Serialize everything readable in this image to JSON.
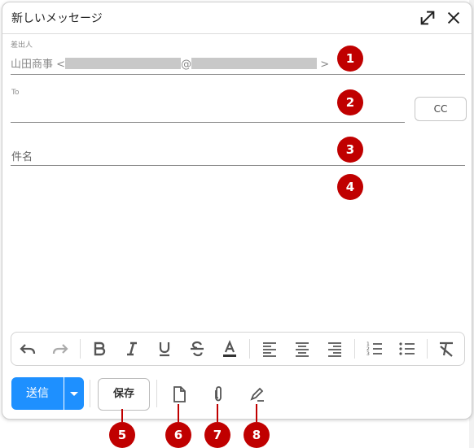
{
  "window": {
    "title": "新しいメッセージ",
    "expand_icon": "expand-icon",
    "close_icon": "close-icon"
  },
  "from": {
    "label": "差出人",
    "name": "山田商事",
    "open": "<",
    "at": "@",
    "close": ">"
  },
  "to": {
    "label": "To",
    "value": "",
    "cc_label": "CC"
  },
  "subject": {
    "placeholder": "件名"
  },
  "toolbar": {
    "items": [
      "undo-icon",
      "redo-icon",
      "bold-icon",
      "italic-icon",
      "underline-icon",
      "strikethrough-icon",
      "text-color-icon",
      "align-left-icon",
      "align-center-icon",
      "align-right-icon",
      "numbered-list-icon",
      "bulleted-list-icon",
      "clear-format-icon"
    ]
  },
  "footer": {
    "send_label": "送信",
    "save_label": "保存",
    "icons": [
      "template-icon",
      "attachment-icon",
      "signature-icon"
    ]
  },
  "annotations": [
    "1",
    "2",
    "3",
    "4",
    "5",
    "6",
    "7",
    "8"
  ],
  "colors": {
    "send": "#1e90ff",
    "badge": "#c00000"
  }
}
